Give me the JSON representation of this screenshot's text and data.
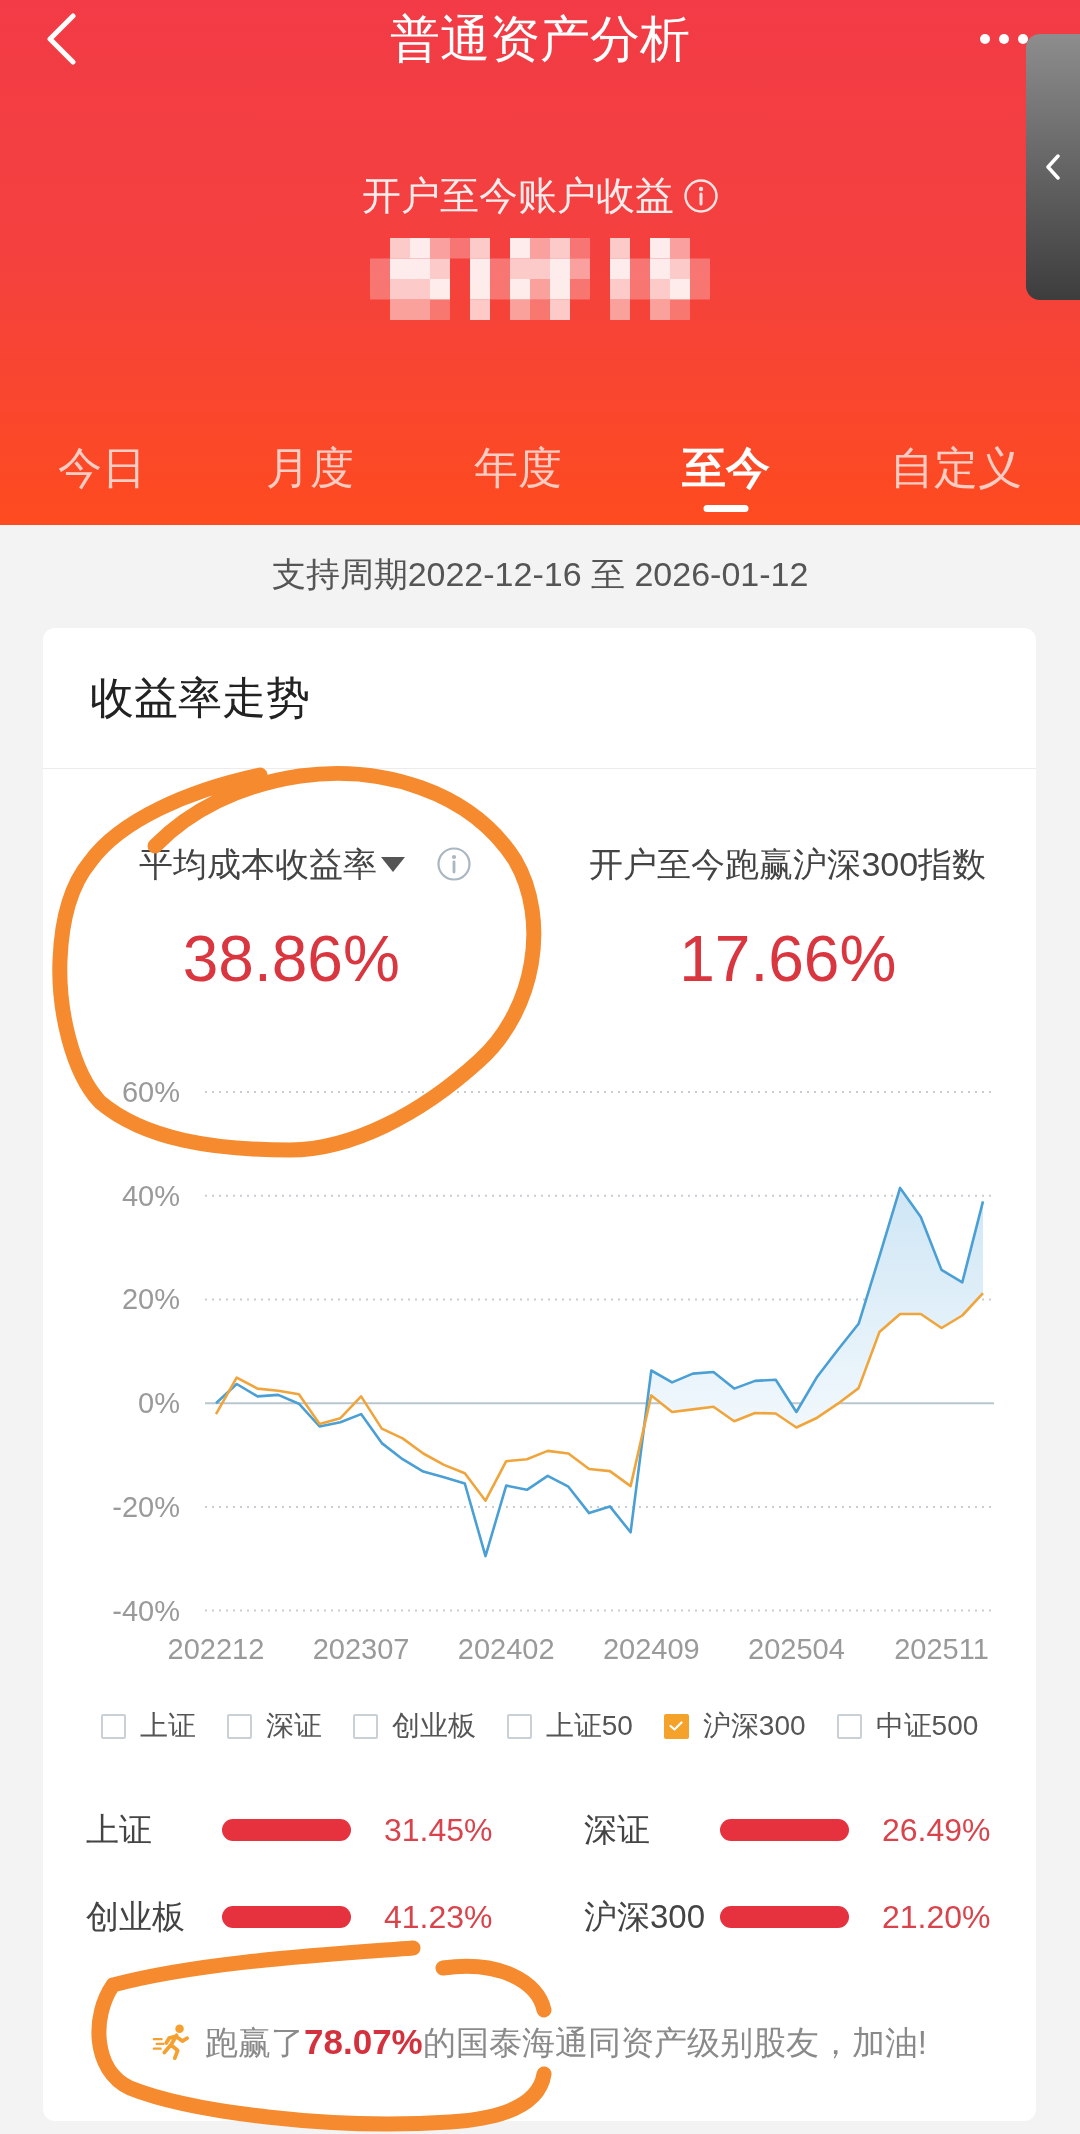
{
  "header": {
    "title": "普通资产分析",
    "subtitle": "开户至今账户收益"
  },
  "tabs": [
    {
      "label": "今日",
      "selected": false
    },
    {
      "label": "月度",
      "selected": false
    },
    {
      "label": "年度",
      "selected": false
    },
    {
      "label": "至今",
      "selected": true
    },
    {
      "label": "自定义",
      "selected": false
    }
  ],
  "period": "支持周期2022-12-16 至 2026-01-12",
  "card": {
    "title": "收益率走势",
    "metrics": [
      {
        "kind": "dropdown",
        "label": "平均成本收益率",
        "value": "38.86%"
      },
      {
        "kind": "plain",
        "label": "开户至今跑赢沪深300指数",
        "value": "17.66%"
      }
    ],
    "chart_data": {
      "type": "line",
      "grid": true,
      "categories": [
        "202212",
        null,
        null,
        null,
        null,
        null,
        null,
        "202307",
        null,
        null,
        null,
        null,
        null,
        null,
        "202402",
        null,
        null,
        null,
        null,
        null,
        null,
        "202409",
        null,
        null,
        null,
        null,
        null,
        null,
        "202504",
        null,
        null,
        null,
        null,
        null,
        null,
        "202511",
        null,
        null
      ],
      "series": [
        {
          "color": "#4a9fd5",
          "values": [
            0,
            3.7,
            1.3,
            1.6,
            -0.1,
            -4.5,
            -3.7,
            -2.1,
            -7.7,
            -10.8,
            -13.2,
            -14.3,
            -15.5,
            -29.5,
            -15.9,
            -16.7,
            -14.0,
            -16.1,
            -21.2,
            -19.9,
            -24.9,
            6.3,
            4.0,
            5.7,
            6.0,
            2.8,
            4.3,
            4.5,
            -1.7,
            5.1,
            10.3,
            15.3,
            28.3,
            41.5,
            35.9,
            25.7,
            23.3,
            38.9
          ]
        },
        {
          "color": "#f0a53c",
          "values": [
            -2.1,
            4.9,
            2.8,
            2.4,
            1.7,
            -4.0,
            -2.9,
            1.3,
            -4.9,
            -6.8,
            -9.7,
            -11.9,
            -13.5,
            -18.8,
            -11.2,
            -10.8,
            -9.2,
            -9.7,
            -12.7,
            -13.1,
            -16.0,
            1.5,
            -1.7,
            -1.2,
            -0.7,
            -3.5,
            -1.9,
            -2.0,
            -4.7,
            -2.8,
            -0.1,
            2.9,
            13.7,
            17.2,
            17.2,
            14.5,
            16.9,
            21.2
          ]
        }
      ],
      "ylim": [
        -40,
        60
      ],
      "yticks": [
        {
          "value": -40,
          "label": "-40%"
        },
        {
          "value": -20,
          "label": "-20%"
        },
        {
          "value": 0,
          "label": "0%"
        },
        {
          "value": 20,
          "label": "20%"
        },
        {
          "value": 40,
          "label": "40%"
        },
        {
          "value": 60,
          "label": "60%"
        }
      ]
    },
    "legend": [
      {
        "label": "上证",
        "checked": false
      },
      {
        "label": "深证",
        "checked": false
      },
      {
        "label": "创业板",
        "checked": false
      },
      {
        "label": "上证50",
        "checked": false
      },
      {
        "label": "沪深300",
        "checked": true
      },
      {
        "label": "中证500",
        "checked": false
      }
    ],
    "comparisons": [
      {
        "name": "上证",
        "value": "31.45%"
      },
      {
        "name": "深证",
        "value": "26.49%"
      },
      {
        "name": "创业板",
        "value": "41.23%"
      },
      {
        "name": "沪深300",
        "value": "21.20%"
      }
    ],
    "summary": "跑赢了**78.07%**的国泰海通同资产级别股友，加油!"
  }
}
